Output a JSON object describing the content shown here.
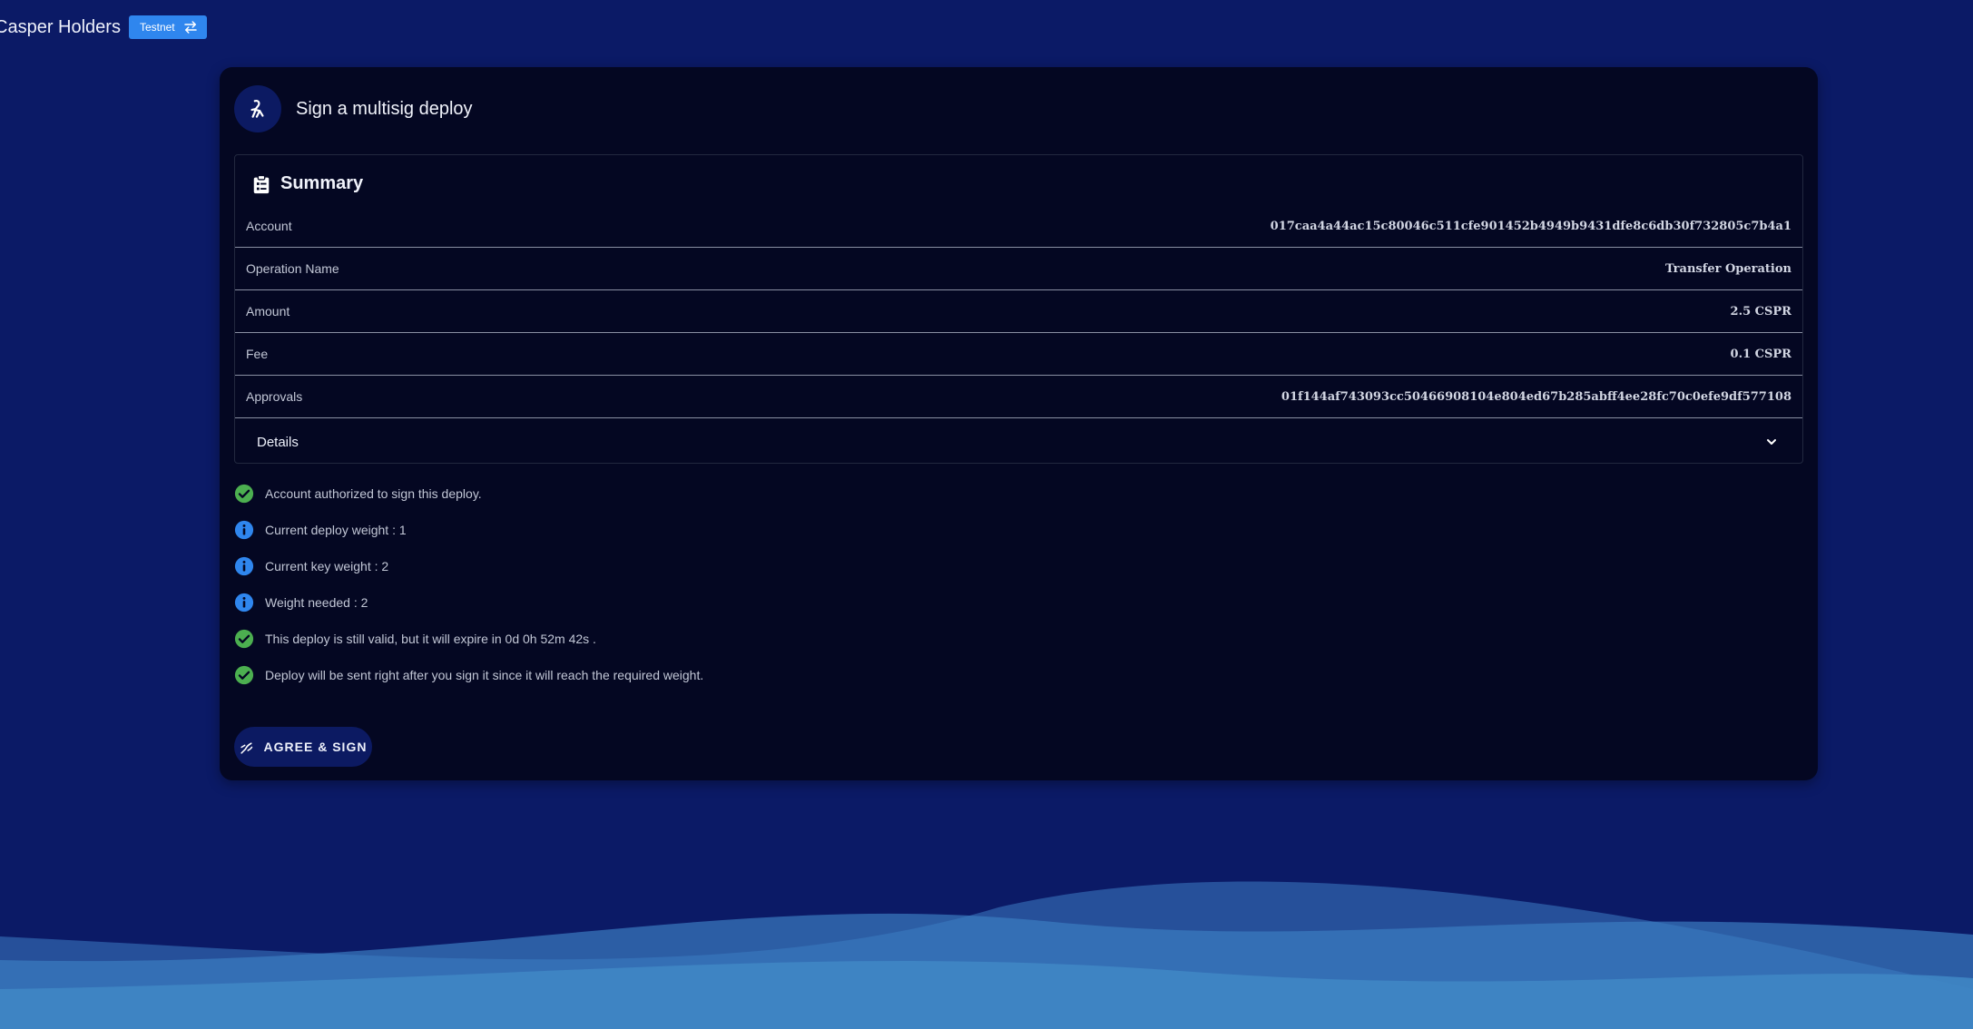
{
  "app": {
    "title": "Casper Holders",
    "network_badge": "Testnet"
  },
  "card": {
    "title": "Sign a multisig deploy"
  },
  "summary": {
    "title": "Summary",
    "rows": [
      {
        "label": "Account",
        "value": "017caa4a44ac15c80046c511cfe901452b4949b9431dfe8c6db30f732805c7b4a1"
      },
      {
        "label": "Operation Name",
        "value": "Transfer Operation"
      },
      {
        "label": "Amount",
        "value": "2.5 CSPR"
      },
      {
        "label": "Fee",
        "value": "0.1 CSPR"
      },
      {
        "label": "Approvals",
        "value": "01f144af743093cc50466908104e804ed67b285abff4ee28fc70c0efe9df577108"
      }
    ],
    "details_label": "Details"
  },
  "checks": [
    {
      "icon": "check-circle-icon",
      "text": "Account authorized to sign this deploy."
    },
    {
      "icon": "info-icon",
      "text": "Current deploy weight : 1"
    },
    {
      "icon": "info-icon",
      "text": "Current key weight : 2"
    },
    {
      "icon": "info-icon",
      "text": "Weight needed : 2"
    },
    {
      "icon": "check-circle-icon",
      "text": "This deploy is still valid, but it will expire in 0d 0h 52m 42s ."
    },
    {
      "icon": "check-circle-icon",
      "text": "Deploy will be sent right after you sign it since it will reach the required weight."
    }
  ],
  "actions": {
    "sign_label": "AGREE & SIGN"
  },
  "colors": {
    "background": "#0b1a66",
    "card": "#040722",
    "badge": "#2f86ee",
    "success": "#4caf50",
    "info": "#2f86ee"
  }
}
